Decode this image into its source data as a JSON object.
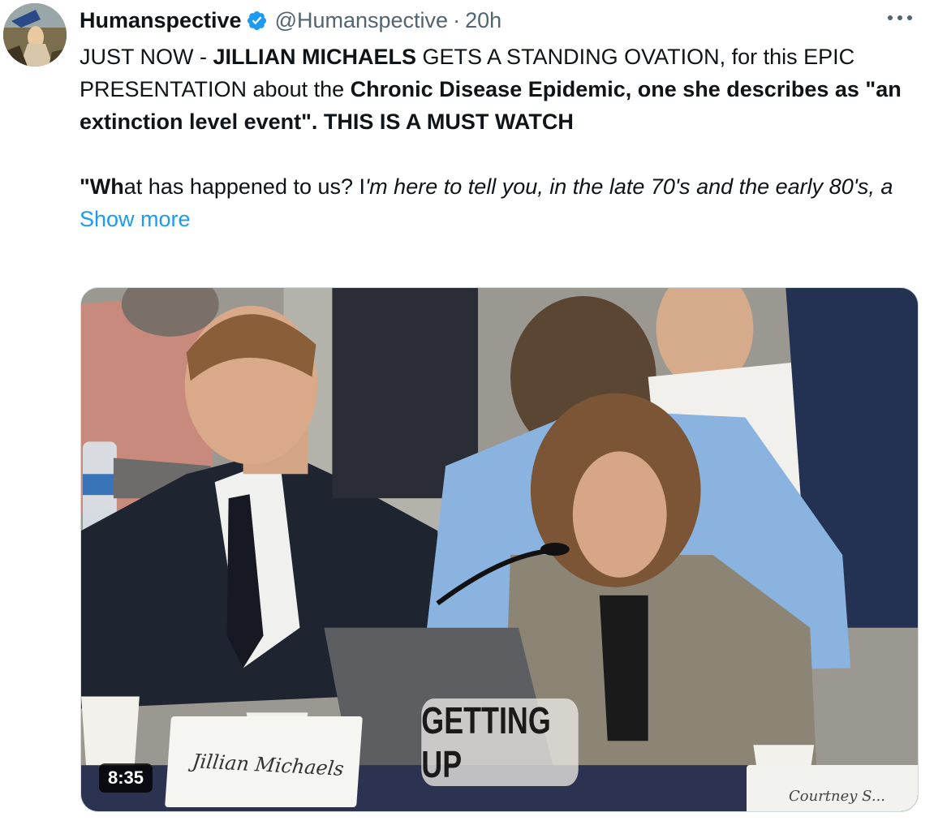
{
  "author": {
    "name": "Humanspective",
    "handle": "@Humanspective",
    "separator": "·",
    "time": "20h",
    "verified": true,
    "avatar_icon": "avatar-image"
  },
  "tweet": {
    "p1_a": "JUST NOW - ",
    "p1_b": "JILLIAN MICHAELS",
    "p1_c": " GETS A STANDING OVATION, for this EPIC PRESENTATION about the ",
    "p1_d": "Chronic Disease Epidemic, one she describes as \"an extinction level event\". THIS IS A MUST WATCH",
    "p2_a": "\"Wh",
    "p2_b": "at has happened to us? I",
    "p2_c": "'m here to tell you, in the late 70's and the early 80's, a",
    "show_more": "Show more"
  },
  "media": {
    "caption": "GETTING UP",
    "nameplate": "Jillian Michaels",
    "nameplate_2": "Courtney S...",
    "duration": "8:35"
  },
  "colors": {
    "link": "#1d9bf0",
    "verified": "#1d9bf0",
    "secondary_text": "#536471"
  },
  "icons": [
    "verified-badge-icon",
    "more-options-icon"
  ]
}
